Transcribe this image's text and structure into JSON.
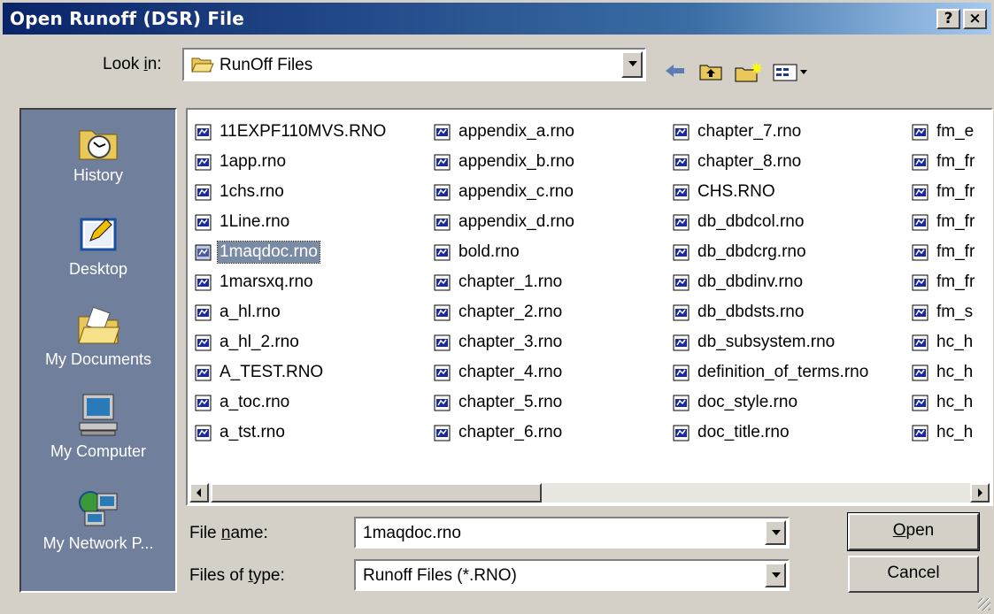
{
  "window": {
    "title": "Open Runoff (DSR) File",
    "help_glyph": "?",
    "close_glyph": "×"
  },
  "look_in": {
    "label_pre": "Look ",
    "label_key": "i",
    "label_post": "n:",
    "value": "RunOff Files"
  },
  "toolbar": {
    "back": "back-arrow",
    "up": "up-folder",
    "new_folder": "new-folder",
    "views": "views-menu"
  },
  "places": [
    {
      "label": "History",
      "icon": "history-icon"
    },
    {
      "label": "Desktop",
      "icon": "desktop-icon"
    },
    {
      "label": "My Documents",
      "icon": "my-documents-icon"
    },
    {
      "label": "My Computer",
      "icon": "my-computer-icon"
    },
    {
      "label": "My Network P...",
      "icon": "network-places-icon"
    }
  ],
  "files": {
    "col1": [
      "11EXPF110MVS.RNO",
      "1app.rno",
      "1chs.rno",
      "1Line.rno",
      "1maqdoc.rno",
      "1marsxq.rno",
      "a_hl.rno",
      "a_hl_2.rno",
      "A_TEST.RNO",
      "a_toc.rno",
      "a_tst.rno"
    ],
    "col2": [
      "appendix_a.rno",
      "appendix_b.rno",
      "appendix_c.rno",
      "appendix_d.rno",
      "bold.rno",
      "chapter_1.rno",
      "chapter_2.rno",
      "chapter_3.rno",
      "chapter_4.rno",
      "chapter_5.rno",
      "chapter_6.rno"
    ],
    "col3": [
      "chapter_7.rno",
      "chapter_8.rno",
      "CHS.RNO",
      "db_dbdcol.rno",
      "db_dbdcrg.rno",
      "db_dbdinv.rno",
      "db_dbdsts.rno",
      "db_subsystem.rno",
      "definition_of_terms.rno",
      "doc_style.rno",
      "doc_title.rno"
    ],
    "col4": [
      "fm_e",
      "fm_fr",
      "fm_fr",
      "fm_fr",
      "fm_fr",
      "fm_fr",
      "fm_s",
      "hc_h",
      "hc_h",
      "hc_h",
      "hc_h"
    ],
    "selected": "1maqdoc.rno"
  },
  "file_name": {
    "label_pre": "File ",
    "label_key": "n",
    "label_post": "ame:",
    "value": "1maqdoc.rno"
  },
  "file_type": {
    "label_pre": "Files of ",
    "label_key": "t",
    "label_post": "ype:",
    "value": "Runoff Files (*.RNO)"
  },
  "buttons": {
    "open_key": "O",
    "open_rest": "pen",
    "cancel": "Cancel"
  }
}
